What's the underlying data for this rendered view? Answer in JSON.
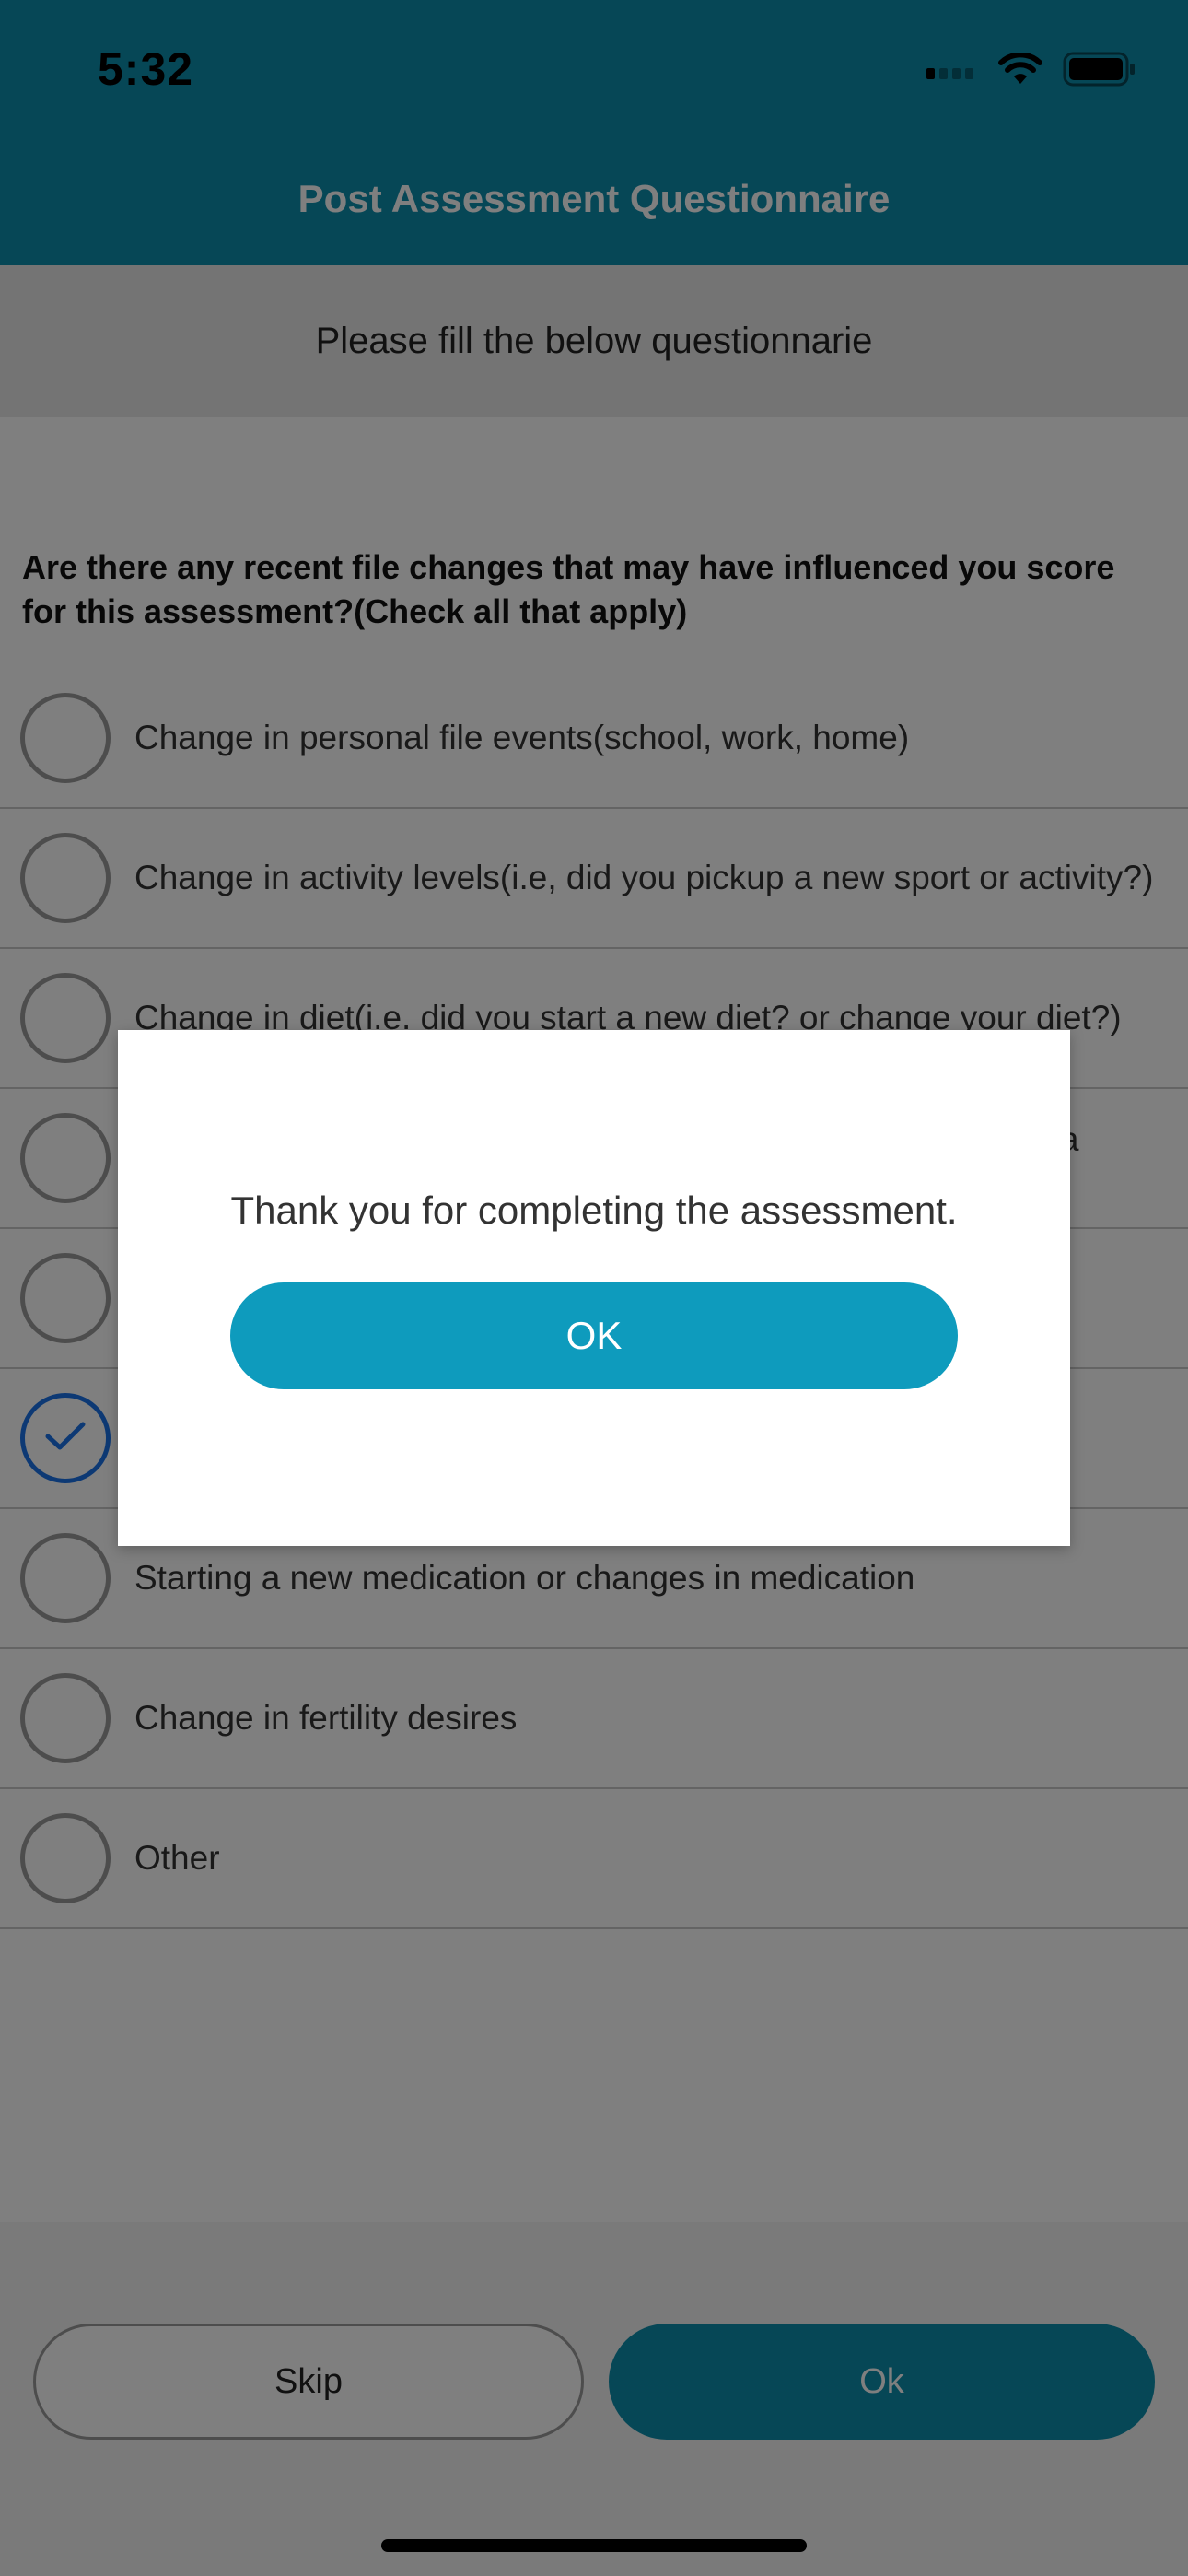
{
  "status_bar": {
    "time": "5:32"
  },
  "header": {
    "title": "Post Assessment Questionnaire"
  },
  "subheader": {
    "text": "Please fill the below questionnarie"
  },
  "question": {
    "text": "Are there any recent file changes that may have influenced you score for this assessment?(Check all that apply)"
  },
  "options": [
    {
      "label": "Change in personal file events(school, work, home)",
      "checked": false
    },
    {
      "label": "Change in activity levels(i.e, did you pickup a new sport or activity?)",
      "checked": false
    },
    {
      "label": "Change in diet(i.e. did you start a new diet? or change your diet?)",
      "checked": false
    },
    {
      "label": "g a",
      "checked": false
    },
    {
      "label": "",
      "checked": false
    },
    {
      "label": "",
      "checked": true
    },
    {
      "label": "Starting a new medication or changes in medication",
      "checked": false
    },
    {
      "label": "Change in fertility desires",
      "checked": false
    },
    {
      "label": "Other",
      "checked": false
    }
  ],
  "footer": {
    "skip_label": "Skip",
    "ok_label": "Ok"
  },
  "dialog": {
    "message": "Thank you for completing the assessment.",
    "ok_label": "OK"
  },
  "colors": {
    "header_teal": "#0c8fad",
    "dialog_button": "#0e9bbd",
    "checked_blue": "#1a73e8"
  }
}
